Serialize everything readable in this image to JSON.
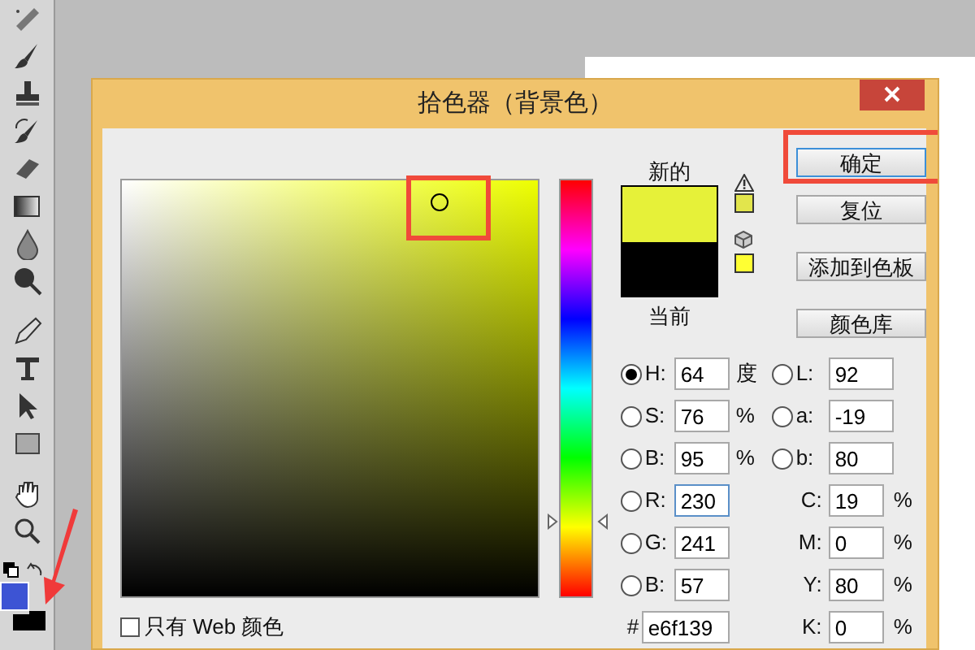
{
  "dialog": {
    "title": "拾色器（背景色）",
    "color_field": {
      "annotated": true
    },
    "hue_slider": {
      "level": 0.178
    },
    "new_label": "新的",
    "current_label": "当前",
    "buttons": [
      {
        "label": "确定",
        "default": true,
        "annotated": true
      },
      {
        "label": "复位",
        "default": false,
        "annotated": false
      },
      {
        "label": "添加到色板",
        "default": false,
        "annotated": false
      },
      {
        "label": "颜色库",
        "default": false,
        "annotated": false
      }
    ],
    "hsb": [
      {
        "label": "H:",
        "value": "64",
        "unit": "度",
        "selected": true
      },
      {
        "label": "S:",
        "value": "76",
        "unit": "%",
        "selected": false
      },
      {
        "label": "B:",
        "value": "95",
        "unit": "%",
        "selected": false
      }
    ],
    "lab": [
      {
        "label": "L:",
        "value": "92",
        "selected": false
      },
      {
        "label": "a:",
        "value": "-19",
        "selected": false
      },
      {
        "label": "b:",
        "value": "80",
        "selected": false
      }
    ],
    "rgb": [
      {
        "label": "R:",
        "value": "230",
        "selected": false,
        "focused": true
      },
      {
        "label": "G:",
        "value": "241",
        "selected": false,
        "focused": false
      },
      {
        "label": "B:",
        "value": "57",
        "selected": false,
        "focused": false
      }
    ],
    "cmyk": [
      {
        "label": "C:",
        "value": "19",
        "unit": "%"
      },
      {
        "label": "M:",
        "value": "0",
        "unit": "%"
      },
      {
        "label": "Y:",
        "value": "80",
        "unit": "%"
      },
      {
        "label": "K:",
        "value": "0",
        "unit": "%"
      }
    ],
    "hex": {
      "label": "#",
      "value": "e6f139"
    },
    "web_only": {
      "label": "只有 Web 颜色",
      "checked": false
    }
  }
}
